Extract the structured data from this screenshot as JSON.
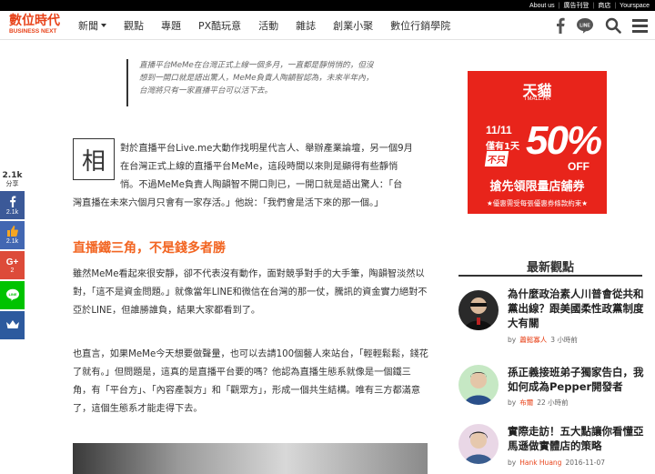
{
  "topbar": {
    "links": [
      "About us",
      "廣告刊登",
      "商店",
      "Yourspace"
    ]
  },
  "header": {
    "logo_zh": "數位時代",
    "logo_en": "BUSINESS NEXT",
    "nav": [
      "新聞",
      "觀點",
      "專題",
      "PX酷玩意",
      "活動",
      "雜誌",
      "創業小聚",
      "數位行銷學院"
    ],
    "icons": [
      "facebook-icon",
      "line-icon",
      "search-icon",
      "menu-icon"
    ],
    "line_label": "LINE"
  },
  "share": {
    "count": "2.1k",
    "label": "分享",
    "buttons": [
      {
        "name": "facebook",
        "count": "2.1k",
        "color": "#3b5998"
      },
      {
        "name": "like",
        "count": "2.1k",
        "color": "#4267b2"
      },
      {
        "name": "google-plus",
        "count": "2",
        "color": "#dd4b39"
      },
      {
        "name": "line",
        "label": "LINE",
        "color": "#00c300"
      },
      {
        "name": "crown",
        "color": "#2d5a9e"
      }
    ],
    "gplus_label": "G+"
  },
  "article": {
    "quote": "直播平台MeMe在台灣正式上線一個多月，一直都是靜悄悄的，但沒想到一開口就是語出驚人，MeMe負責人陶韻智認為，未來半年內，台灣將只有一家直播平台可以活下去。",
    "dropcap": "相",
    "p1_lines": [
      "對於直播平台Live.me大動作找明星代言人、舉辦產業論壇，另一個9月",
      "在台灣正式上線的直播平台MeMe，這段時間以來則是顯得有些靜悄",
      "悄。不過MeMe負責人陶韻智不開口則已，一開口就是語出驚人：「台",
      "灣直播在未來六個月只會有一家存活。」他說：「我們會是活下來的那一個。」"
    ],
    "h2": "直播鐵三角，不是錢多者勝",
    "p2": "雖然MeMe看起來很安靜，卻不代表沒有動作，面對競爭對手的大手筆，陶韻智淡然以對，「這不是資金問題。」就像當年LINE和微信在台灣的那一仗，騰訊的資金實力絕對不亞於LINE，但誰勝誰負，結果大家都看到了。",
    "p3": "也直言，如果MeMe今天想要做聲量，也可以去請100個藝人來站台，「輕輕鬆鬆，錢花了就有。」但問題是，這真的是直播平台要的嗎？他認為直播生態系就像是一個鐵三角，有「平台方」、「內容產製方」和「觀眾方」，形成一個共生結構。唯有三方都滿意了，這個生態系才能走得下去。"
  },
  "ad": {
    "brand": "天貓",
    "brand_en": "TMALL.HK",
    "date": "11/11",
    "limit": "僅有1天",
    "only": "不只",
    "percent": "50%",
    "off": "OFF",
    "tagline": "搶先領限量店舖券",
    "footnote": "★優惠需受每張優惠券條款約束★",
    "color": "#e8241b"
  },
  "sidebar": {
    "latest_title": "最新觀點",
    "by": "by",
    "articles": [
      {
        "title": "為什麼政治素人川普會從共和黨出線？跟美國柔性政黨制度大有關",
        "author": "蕭懿寡人",
        "time": "3 小時前"
      },
      {
        "title": "孫正義接班弟子獨家告白，我如何成為Pepper開發者",
        "author": "布爾",
        "time": "22 小時前"
      },
      {
        "title": "實際走訪！五大點讓你看懂亞馬遜做實體店的策略",
        "author": "Hank Huang",
        "time": "2016-11-07"
      }
    ]
  },
  "colors": {
    "accent": "#e8431a",
    "heading_orange": "#f26522"
  }
}
